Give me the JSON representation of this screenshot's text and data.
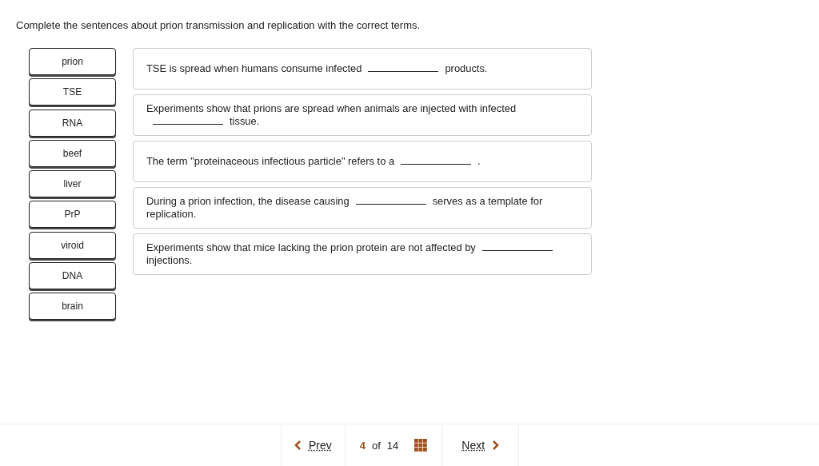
{
  "instruction": "Complete the sentences about prion transmission and replication with the correct terms.",
  "terms": [
    "prion",
    "TSE",
    "RNA",
    "beef",
    "liver",
    "PrP",
    "viroid",
    "DNA",
    "brain"
  ],
  "sentences": [
    {
      "parts": [
        {
          "kind": "text",
          "text": "TSE is spread when humans consume infected"
        },
        {
          "kind": "blank"
        },
        {
          "kind": "text",
          "text": "products."
        }
      ]
    },
    {
      "parts": [
        {
          "kind": "text",
          "text": "Experiments show that prions are spread when animals are injected with infected"
        },
        {
          "kind": "blank"
        },
        {
          "kind": "text",
          "text": "tissue."
        }
      ]
    },
    {
      "parts": [
        {
          "kind": "text",
          "text": "The term \"proteinaceous infectious particle\" refers to a"
        },
        {
          "kind": "blank"
        },
        {
          "kind": "text",
          "text": "."
        }
      ]
    },
    {
      "parts": [
        {
          "kind": "text",
          "text": "During a prion infection, the disease causing"
        },
        {
          "kind": "blank"
        },
        {
          "kind": "text",
          "text": "serves as a template for"
        },
        {
          "kind": "break"
        },
        {
          "kind": "text",
          "text": "replication."
        }
      ]
    },
    {
      "parts": [
        {
          "kind": "text",
          "text": "Experiments show that mice lacking the prion protein are not affected by"
        },
        {
          "kind": "blank"
        },
        {
          "kind": "text",
          "text": "injections."
        }
      ]
    }
  ],
  "pager": {
    "prev": "Prev",
    "current": "4",
    "of": "of",
    "total": "14",
    "next": "Next"
  }
}
